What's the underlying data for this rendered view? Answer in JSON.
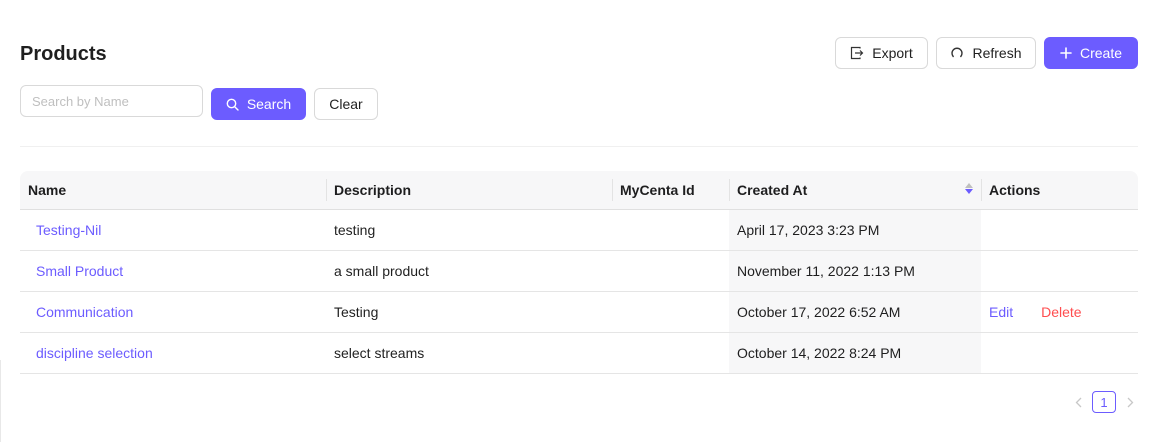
{
  "page": {
    "title": "Products"
  },
  "toolbar": {
    "export_label": "Export",
    "refresh_label": "Refresh",
    "create_label": "Create"
  },
  "search": {
    "placeholder": "Search by Name",
    "value": "",
    "search_label": "Search",
    "clear_label": "Clear"
  },
  "table": {
    "columns": [
      "Name",
      "Description",
      "MyCenta Id",
      "Created At",
      "Actions"
    ],
    "sorted_column": "Created At",
    "sort_order": "descending",
    "rows": [
      {
        "name": "Testing-Nil",
        "description": "testing",
        "mycenta_id": "",
        "created_at": "April 17, 2023 3:23 PM",
        "actions": []
      },
      {
        "name": "Small Product",
        "description": "a small product",
        "mycenta_id": "",
        "created_at": "November 11, 2022 1:13 PM",
        "actions": []
      },
      {
        "name": "Communication",
        "description": "Testing",
        "mycenta_id": "",
        "created_at": "October 17, 2022 6:52 AM",
        "actions": [
          "Edit",
          "Delete"
        ]
      },
      {
        "name": "discipline selection",
        "description": "select streams",
        "mycenta_id": "",
        "created_at": "October 14, 2022 8:24 PM",
        "actions": []
      }
    ]
  },
  "pagination": {
    "current_page": "1"
  },
  "colors": {
    "primary": "#6c5cff",
    "danger": "#ff4d4f",
    "header_bg": "#f7f7f8"
  },
  "icons": {
    "export": "export-icon",
    "refresh": "refresh-icon",
    "create": "plus-icon",
    "search": "search-icon",
    "sort": "sort-caret-icon",
    "prev": "chevron-left-icon",
    "next": "chevron-right-icon"
  }
}
